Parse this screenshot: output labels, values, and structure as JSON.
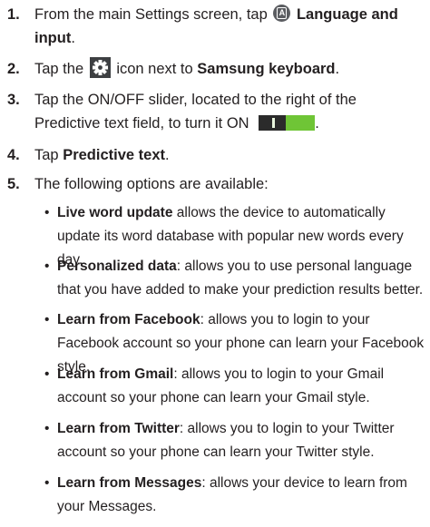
{
  "steps": [
    {
      "num": "1.",
      "pre": "From the main Settings screen, tap",
      "icon": "language-a-icon",
      "bold": "Language and input",
      "post": "."
    },
    {
      "num": "2.",
      "pre": "Tap the",
      "icon": "gear-icon",
      "mid": "icon next to",
      "bold": "Samsung keyboard",
      "post": "."
    },
    {
      "num": "3.",
      "text": "Tap the ON/OFF slider, located to the right of the Predictive text field, to turn it ON",
      "icon": "on-toggle-icon",
      "post": "."
    },
    {
      "num": "4.",
      "pre": "Tap",
      "bold": "Predictive text",
      "post": "."
    },
    {
      "num": "5.",
      "text": "The following options are available:"
    }
  ],
  "options": [
    {
      "bold": "Live word update",
      "text": " allows the device to automatically update its word database with popular new words every day."
    },
    {
      "bold": "Personalized data",
      "text": ": allows you to use personal language that you have added to make your prediction results better."
    },
    {
      "bold": "Learn from Facebook",
      "text": ": allows you to login to your Facebook account so your phone can learn your Facebook style."
    },
    {
      "bold": "Learn from Gmail",
      "text": ": allows you to login to your Gmail account so your phone can learn your Gmail style."
    },
    {
      "bold": "Learn from Twitter",
      "text": ": allows you to login to your Twitter account so your phone can learn your Twitter style."
    },
    {
      "bold": "Learn from Messages",
      "text": ": allows your device to learn from your Messages."
    }
  ],
  "bullet_char": "•",
  "colors": {
    "text": "#231f20",
    "toggle_on": "#6fc536",
    "toggle_off": "#2b2b2b",
    "icon_gray": "#5b5d61"
  }
}
